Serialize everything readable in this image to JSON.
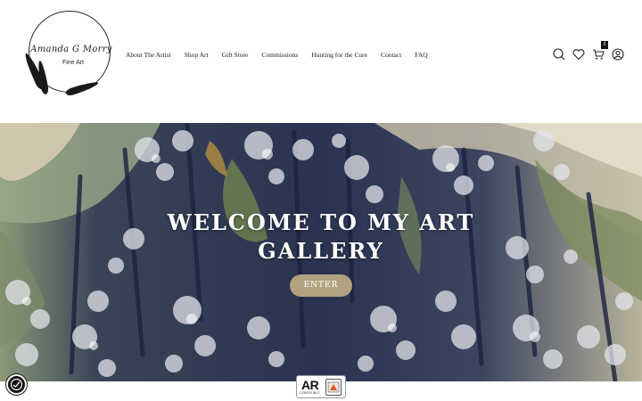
{
  "logo": {
    "name": "Amanda G Morry",
    "subtitle": "Fine Art"
  },
  "nav": {
    "items": [
      "About The Artist",
      "Shop Art",
      "Gift Store",
      "Commissions",
      "Hunting for the Cure",
      "Contact",
      "FAQ"
    ]
  },
  "header_icons": {
    "search": "search-icon",
    "wishlist": "heart-icon",
    "cart": "cart-icon",
    "account": "user-icon",
    "cart_count": "0"
  },
  "hero": {
    "title": "WELCOME TO MY ART GALLERY",
    "button": "ENTER"
  },
  "ar_badge": {
    "label": "AR",
    "sublabel": "COMPATIBLE"
  },
  "colors": {
    "button": "#b3a27f",
    "hero_dark": "#2b3450",
    "text": "#222222"
  }
}
